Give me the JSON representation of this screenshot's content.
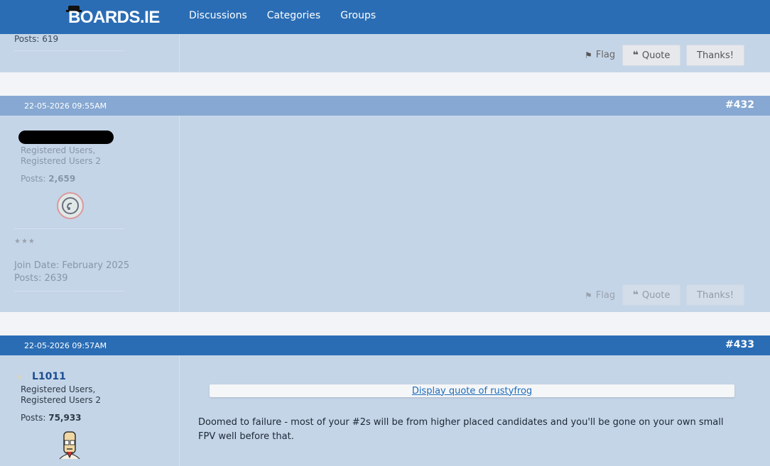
{
  "nav": {
    "logo": "BOARDS.IE",
    "links": [
      "Discussions",
      "Categories",
      "Groups"
    ]
  },
  "post_prev": {
    "posts_label": "Posts: 619",
    "flag": "Flag",
    "quote": "Quote",
    "thanks": "Thanks!"
  },
  "post_432": {
    "date": "22-05-2026 09:55AM",
    "number": "#432",
    "roles_line1": "Registered Users,",
    "roles_line2": "Registered Users 2",
    "posts_prefix": "Posts: ",
    "posts_count": "2,659",
    "stars": "★★★",
    "join_date": "Join Date: February 2025",
    "posts_total": "Posts: 2639",
    "flag": "Flag",
    "quote": "Quote",
    "thanks": "Thanks!"
  },
  "post_433": {
    "date": "22-05-2026 09:57AM",
    "number": "#433",
    "username": "L1011",
    "roles_line1": "Registered Users,",
    "roles_line2": "Registered Users 2",
    "posts_prefix": "Posts: ",
    "posts_count": "75,933",
    "quote_link": "Display quote of rustyfrog",
    "body_line1": "Doomed to failure - most of your #2s will be from higher placed candidates and you'll be gone on your own small",
    "body_line2": "FPV well before that."
  },
  "colors": {
    "nav_bg": "#2a6db5",
    "header_active": "#2a6db5",
    "header_faded": "#86a8d2",
    "post_bg": "#c5d5e8",
    "link": "#2a6db5"
  }
}
